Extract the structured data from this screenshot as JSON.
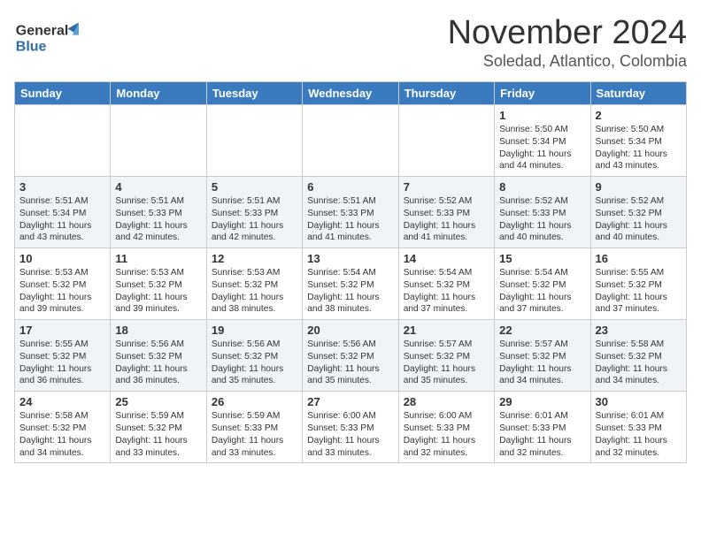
{
  "header": {
    "logo_line1": "General",
    "logo_line2": "Blue",
    "month": "November 2024",
    "location": "Soledad, Atlantico, Colombia"
  },
  "weekdays": [
    "Sunday",
    "Monday",
    "Tuesday",
    "Wednesday",
    "Thursday",
    "Friday",
    "Saturday"
  ],
  "weeks": [
    [
      {
        "day": "",
        "text": ""
      },
      {
        "day": "",
        "text": ""
      },
      {
        "day": "",
        "text": ""
      },
      {
        "day": "",
        "text": ""
      },
      {
        "day": "",
        "text": ""
      },
      {
        "day": "1",
        "text": "Sunrise: 5:50 AM\nSunset: 5:34 PM\nDaylight: 11 hours\nand 44 minutes."
      },
      {
        "day": "2",
        "text": "Sunrise: 5:50 AM\nSunset: 5:34 PM\nDaylight: 11 hours\nand 43 minutes."
      }
    ],
    [
      {
        "day": "3",
        "text": "Sunrise: 5:51 AM\nSunset: 5:34 PM\nDaylight: 11 hours\nand 43 minutes."
      },
      {
        "day": "4",
        "text": "Sunrise: 5:51 AM\nSunset: 5:33 PM\nDaylight: 11 hours\nand 42 minutes."
      },
      {
        "day": "5",
        "text": "Sunrise: 5:51 AM\nSunset: 5:33 PM\nDaylight: 11 hours\nand 42 minutes."
      },
      {
        "day": "6",
        "text": "Sunrise: 5:51 AM\nSunset: 5:33 PM\nDaylight: 11 hours\nand 41 minutes."
      },
      {
        "day": "7",
        "text": "Sunrise: 5:52 AM\nSunset: 5:33 PM\nDaylight: 11 hours\nand 41 minutes."
      },
      {
        "day": "8",
        "text": "Sunrise: 5:52 AM\nSunset: 5:33 PM\nDaylight: 11 hours\nand 40 minutes."
      },
      {
        "day": "9",
        "text": "Sunrise: 5:52 AM\nSunset: 5:32 PM\nDaylight: 11 hours\nand 40 minutes."
      }
    ],
    [
      {
        "day": "10",
        "text": "Sunrise: 5:53 AM\nSunset: 5:32 PM\nDaylight: 11 hours\nand 39 minutes."
      },
      {
        "day": "11",
        "text": "Sunrise: 5:53 AM\nSunset: 5:32 PM\nDaylight: 11 hours\nand 39 minutes."
      },
      {
        "day": "12",
        "text": "Sunrise: 5:53 AM\nSunset: 5:32 PM\nDaylight: 11 hours\nand 38 minutes."
      },
      {
        "day": "13",
        "text": "Sunrise: 5:54 AM\nSunset: 5:32 PM\nDaylight: 11 hours\nand 38 minutes."
      },
      {
        "day": "14",
        "text": "Sunrise: 5:54 AM\nSunset: 5:32 PM\nDaylight: 11 hours\nand 37 minutes."
      },
      {
        "day": "15",
        "text": "Sunrise: 5:54 AM\nSunset: 5:32 PM\nDaylight: 11 hours\nand 37 minutes."
      },
      {
        "day": "16",
        "text": "Sunrise: 5:55 AM\nSunset: 5:32 PM\nDaylight: 11 hours\nand 37 minutes."
      }
    ],
    [
      {
        "day": "17",
        "text": "Sunrise: 5:55 AM\nSunset: 5:32 PM\nDaylight: 11 hours\nand 36 minutes."
      },
      {
        "day": "18",
        "text": "Sunrise: 5:56 AM\nSunset: 5:32 PM\nDaylight: 11 hours\nand 36 minutes."
      },
      {
        "day": "19",
        "text": "Sunrise: 5:56 AM\nSunset: 5:32 PM\nDaylight: 11 hours\nand 35 minutes."
      },
      {
        "day": "20",
        "text": "Sunrise: 5:56 AM\nSunset: 5:32 PM\nDaylight: 11 hours\nand 35 minutes."
      },
      {
        "day": "21",
        "text": "Sunrise: 5:57 AM\nSunset: 5:32 PM\nDaylight: 11 hours\nand 35 minutes."
      },
      {
        "day": "22",
        "text": "Sunrise: 5:57 AM\nSunset: 5:32 PM\nDaylight: 11 hours\nand 34 minutes."
      },
      {
        "day": "23",
        "text": "Sunrise: 5:58 AM\nSunset: 5:32 PM\nDaylight: 11 hours\nand 34 minutes."
      }
    ],
    [
      {
        "day": "24",
        "text": "Sunrise: 5:58 AM\nSunset: 5:32 PM\nDaylight: 11 hours\nand 34 minutes."
      },
      {
        "day": "25",
        "text": "Sunrise: 5:59 AM\nSunset: 5:32 PM\nDaylight: 11 hours\nand 33 minutes."
      },
      {
        "day": "26",
        "text": "Sunrise: 5:59 AM\nSunset: 5:33 PM\nDaylight: 11 hours\nand 33 minutes."
      },
      {
        "day": "27",
        "text": "Sunrise: 6:00 AM\nSunset: 5:33 PM\nDaylight: 11 hours\nand 33 minutes."
      },
      {
        "day": "28",
        "text": "Sunrise: 6:00 AM\nSunset: 5:33 PM\nDaylight: 11 hours\nand 32 minutes."
      },
      {
        "day": "29",
        "text": "Sunrise: 6:01 AM\nSunset: 5:33 PM\nDaylight: 11 hours\nand 32 minutes."
      },
      {
        "day": "30",
        "text": "Sunrise: 6:01 AM\nSunset: 5:33 PM\nDaylight: 11 hours\nand 32 minutes."
      }
    ]
  ]
}
